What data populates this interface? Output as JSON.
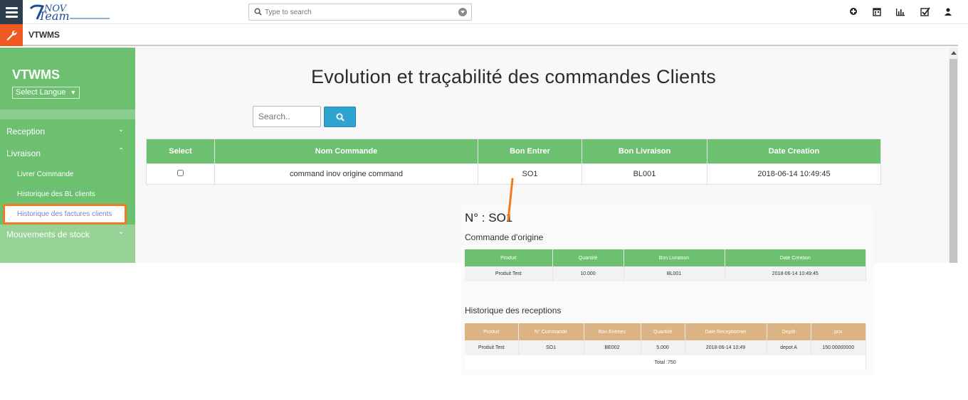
{
  "topbar": {
    "search_placeholder": "Type to search",
    "icons": [
      "plus-circle-icon",
      "calendar-icon",
      "bar-chart-icon",
      "checkbox-icon",
      "user-icon"
    ]
  },
  "breadcrumb": {
    "app": "VTWMS"
  },
  "sidebar": {
    "brand": "VTWMS",
    "language_select": "Select Langue",
    "items": {
      "reception": "Reception",
      "livraison": "Livraison",
      "livrer_commande": "Livrer Commande",
      "historique_bl": "Historique des BL clients",
      "historique_factures": "Historique des factures clients",
      "mouvements": "Mouvements de stock"
    }
  },
  "main": {
    "title": "Evolution et traçabilité des commandes Clients",
    "search_placeholder": "Search..",
    "table": {
      "headers": [
        "Select",
        "Nom Commande",
        "Bon Entrer",
        "Bon Livraison",
        "Date Creation"
      ],
      "rows": [
        {
          "nom": "command inov origine command",
          "bon_entrer": "SO1",
          "bon_livraison": "BL001",
          "date": "2018-06-14 10:49:45"
        }
      ]
    }
  },
  "inset": {
    "number": "N° : SO1",
    "origin_title": "Commande d'origine",
    "origin_headers": [
      "Produit",
      "Quantité",
      "Bon Livraison",
      "Date Création"
    ],
    "origin_row": [
      "Produit Test",
      "10.000",
      "BL001",
      "2018-06-14 10:49:45"
    ],
    "history_title": "Historique des receptions",
    "history_headers": [
      "Produit",
      "N° Commande",
      "Bon Entrées",
      "Quantité",
      "Date Receptionner",
      "Depôt",
      "prix"
    ],
    "history_row": [
      "Produit Test",
      "SO1",
      "BE002",
      "5.000",
      "2018-06-14 10:49",
      "depot A",
      "150.00000000"
    ],
    "total": "Total :750"
  },
  "colors": {
    "green": "#6cc070",
    "orange": "#f05a22",
    "blue": "#2fa4d0",
    "tan": "#dcb382"
  }
}
